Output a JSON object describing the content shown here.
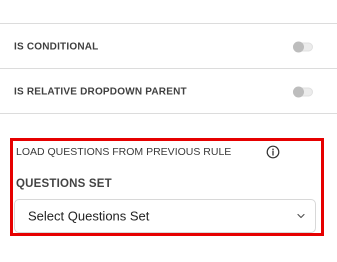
{
  "toggles": [
    {
      "label": "IS CONDITIONAL",
      "enabled": false
    },
    {
      "label": "IS RELATIVE DROPDOWN PARENT",
      "enabled": false
    }
  ],
  "load_section": {
    "label": "LOAD QUESTIONS FROM PREVIOUS RULE",
    "info_icon": "info-circle-icon"
  },
  "questions_set": {
    "label": "QUESTIONS SET",
    "selected": "Select Questions Set",
    "dropdown_icon": "chevron-down-icon"
  },
  "colors": {
    "highlight": "#e60000",
    "divider": "#dcdcdc",
    "toggle_off_knob": "#bdbdbd"
  }
}
